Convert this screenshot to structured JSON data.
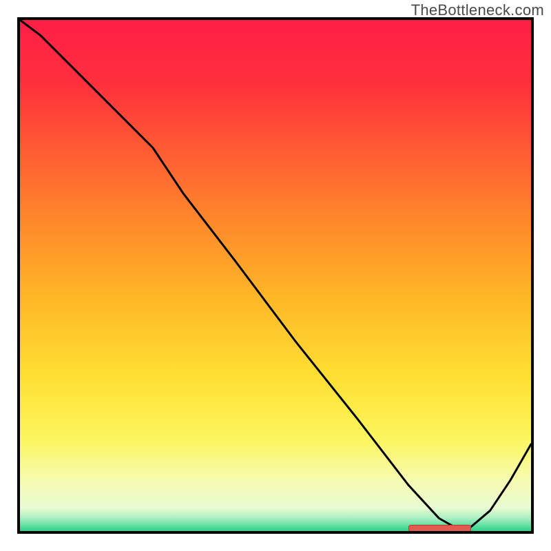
{
  "watermark": "TheBottleneck.com",
  "chart_data": {
    "type": "line",
    "title": "",
    "xlabel": "",
    "ylabel": "",
    "xlim": [
      0,
      100
    ],
    "ylim": [
      0,
      100
    ],
    "background": {
      "gradient_stops": [
        {
          "pos": 0.0,
          "color": "#ff1f46"
        },
        {
          "pos": 0.12,
          "color": "#ff2f3d"
        },
        {
          "pos": 0.25,
          "color": "#ff5a33"
        },
        {
          "pos": 0.4,
          "color": "#ff8a2a"
        },
        {
          "pos": 0.55,
          "color": "#ffb927"
        },
        {
          "pos": 0.7,
          "color": "#ffe033"
        },
        {
          "pos": 0.82,
          "color": "#fcf65e"
        },
        {
          "pos": 0.9,
          "color": "#f7fbb0"
        },
        {
          "pos": 0.955,
          "color": "#e9fbd3"
        },
        {
          "pos": 0.975,
          "color": "#a8efc0"
        },
        {
          "pos": 1.0,
          "color": "#2ad38a"
        }
      ]
    },
    "series": [
      {
        "name": "curve",
        "x": [
          0.0,
          4.0,
          12.0,
          22.0,
          26.0,
          32.0,
          42.0,
          54.0,
          66.0,
          76.0,
          82.0,
          85.0,
          88.0,
          92.0,
          96.0,
          100.0
        ],
        "y": [
          100.0,
          97.0,
          89.0,
          79.0,
          75.0,
          66.0,
          53.0,
          37.0,
          22.0,
          9.0,
          2.5,
          0.8,
          0.6,
          4.0,
          10.0,
          17.0
        ],
        "stroke": "#000000",
        "stroke_width": 3
      }
    ],
    "marker_segment": {
      "x_start": 76,
      "x_end": 88,
      "y": 0.7,
      "color": "#e15b4f"
    }
  }
}
